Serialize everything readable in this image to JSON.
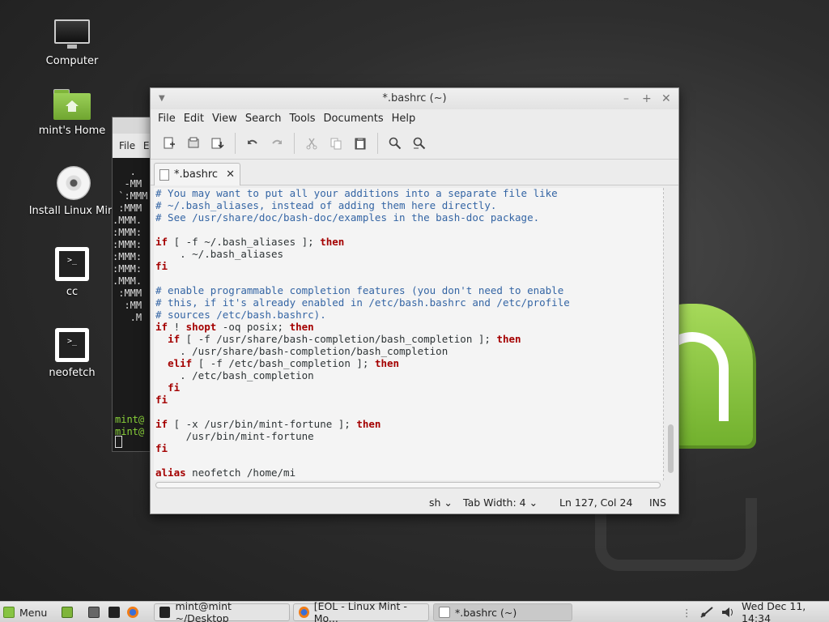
{
  "desktop": {
    "icons": [
      {
        "label": "Computer",
        "icon": "computer-icon"
      },
      {
        "label": "mint's Home",
        "icon": "home-folder-icon"
      },
      {
        "label": "Install Linux Mint",
        "icon": "disc-icon"
      },
      {
        "label": "cc",
        "icon": "terminal-launcher-icon"
      },
      {
        "label": "neofetch",
        "icon": "terminal-launcher-icon"
      }
    ]
  },
  "terminal": {
    "menu_file": "File",
    "menu_edit_partial": "E",
    "prompt_lines": [
      "mint@",
      "mint@"
    ],
    "art_lines": [
      "   .",
      "  -MM",
      " `:MMM",
      " :MMM",
      ".MMM.",
      ":MMM:",
      ":MMM:",
      ":MMM:",
      ":MMM:",
      ".MMM.",
      " :MMM",
      "  :MM",
      "   .M"
    ]
  },
  "editor": {
    "title": "*.bashrc (~)",
    "menu": [
      "File",
      "Edit",
      "View",
      "Search",
      "Tools",
      "Documents",
      "Help"
    ],
    "toolbar_icons": [
      "new-document-icon",
      "open-icon",
      "save-icon",
      "undo-icon",
      "redo-icon",
      "cut-icon",
      "copy-icon",
      "paste-icon",
      "search-icon",
      "search-replace-icon"
    ],
    "tab_label": "*.bashrc",
    "code_lines": [
      [
        {
          "t": "# You may want to put all your additions into a separate file like",
          "c": "com"
        }
      ],
      [
        {
          "t": "# ~/.bash_aliases, instead of adding them here directly.",
          "c": "com"
        }
      ],
      [
        {
          "t": "# See /usr/share/doc/bash-doc/examples in the bash-doc package.",
          "c": "com"
        }
      ],
      [
        {
          "t": "",
          "c": "txt"
        }
      ],
      [
        {
          "t": "if",
          "c": "kw"
        },
        {
          "t": " [ -f ~/.bash_aliases ]; ",
          "c": "txt"
        },
        {
          "t": "then",
          "c": "kw"
        }
      ],
      [
        {
          "t": "    . ~/.bash_aliases",
          "c": "txt"
        }
      ],
      [
        {
          "t": "fi",
          "c": "kw"
        }
      ],
      [
        {
          "t": "",
          "c": "txt"
        }
      ],
      [
        {
          "t": "# enable programmable completion features (you don't need to enable",
          "c": "com"
        }
      ],
      [
        {
          "t": "# this, if it's already enabled in /etc/bash.bashrc and /etc/profile",
          "c": "com"
        }
      ],
      [
        {
          "t": "# sources /etc/bash.bashrc).",
          "c": "com"
        }
      ],
      [
        {
          "t": "if",
          "c": "kw"
        },
        {
          "t": " ! ",
          "c": "txt"
        },
        {
          "t": "shopt",
          "c": "kw"
        },
        {
          "t": " -oq posix; ",
          "c": "txt"
        },
        {
          "t": "then",
          "c": "kw"
        }
      ],
      [
        {
          "t": "  ",
          "c": "txt"
        },
        {
          "t": "if",
          "c": "kw"
        },
        {
          "t": " [ -f /usr/share/bash-completion/bash_completion ]; ",
          "c": "txt"
        },
        {
          "t": "then",
          "c": "kw"
        }
      ],
      [
        {
          "t": "    . /usr/share/bash-completion/bash_completion",
          "c": "txt"
        }
      ],
      [
        {
          "t": "  ",
          "c": "txt"
        },
        {
          "t": "elif",
          "c": "kw"
        },
        {
          "t": " [ -f /etc/bash_completion ]; ",
          "c": "txt"
        },
        {
          "t": "then",
          "c": "kw"
        }
      ],
      [
        {
          "t": "    . /etc/bash_completion",
          "c": "txt"
        }
      ],
      [
        {
          "t": "  ",
          "c": "txt"
        },
        {
          "t": "fi",
          "c": "kw"
        }
      ],
      [
        {
          "t": "fi",
          "c": "kw"
        }
      ],
      [
        {
          "t": "",
          "c": "txt"
        }
      ],
      [
        {
          "t": "if",
          "c": "kw"
        },
        {
          "t": " [ -x /usr/bin/mint-fortune ]; ",
          "c": "txt"
        },
        {
          "t": "then",
          "c": "kw"
        }
      ],
      [
        {
          "t": "     /usr/bin/mint-fortune",
          "c": "txt"
        }
      ],
      [
        {
          "t": "fi",
          "c": "kw"
        }
      ],
      [
        {
          "t": "",
          "c": "txt"
        }
      ],
      [
        {
          "t": "alias",
          "c": "kw"
        },
        {
          "t": " neofetch /home/mi",
          "c": "txt"
        }
      ]
    ],
    "status": {
      "language": "sh",
      "tab_width": "Tab Width:  4",
      "position": "Ln 127, Col 24",
      "mode": "INS"
    }
  },
  "taskbar": {
    "menu_label": "Menu",
    "windows": [
      {
        "label": "mint@mint ~/Desktop",
        "icon": "terminal-icon",
        "active": false
      },
      {
        "label": "[EOL - Linux Mint - Mo...",
        "icon": "firefox-icon",
        "active": false
      },
      {
        "label": "*.bashrc (~)",
        "icon": "text-editor-icon",
        "active": true
      }
    ],
    "clock": "Wed Dec 11, 14:34"
  },
  "colors": {
    "comment": "#3465a4",
    "keyword": "#a40000",
    "mint_green": "#87c443"
  }
}
